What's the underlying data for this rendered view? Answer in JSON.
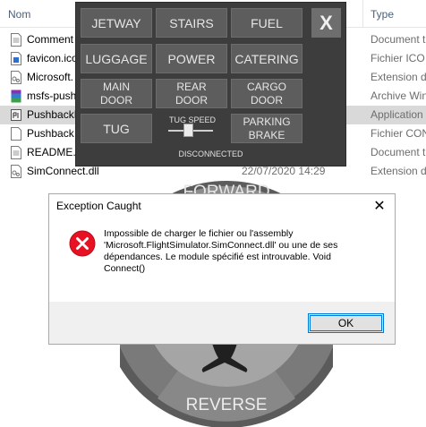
{
  "explorer": {
    "columns": {
      "name": "Nom",
      "type": "Type"
    },
    "files": [
      {
        "name": "Comment",
        "type": "Document t",
        "date": ""
      },
      {
        "name": "favicon.ico",
        "type": "Fichier ICO",
        "date": ""
      },
      {
        "name": "Microsoft.",
        "type": "Extension d",
        "date": ""
      },
      {
        "name": "msfs-push",
        "type": "Archive Win",
        "date": ""
      },
      {
        "name": "PushbackH",
        "type": "Application",
        "date": ""
      },
      {
        "name": "Pushback",
        "type": "Fichier CON",
        "date": ""
      },
      {
        "name": "README.t",
        "type": "Document t",
        "date": ""
      },
      {
        "name": "SimConnect.dll",
        "type": "Extension d",
        "date": "22/07/2020 14:29"
      }
    ]
  },
  "panel": {
    "buttons": {
      "jetway": "JETWAY",
      "stairs": "STAIRS",
      "fuel": "FUEL",
      "luggage": "LUGGAGE",
      "power": "POWER",
      "catering": "CATERING",
      "main_door_1": "MAIN",
      "main_door_2": "DOOR",
      "rear_door_1": "REAR",
      "rear_door_2": "DOOR",
      "cargo_door_1": "CARGO",
      "cargo_door_2": "DOOR",
      "tug": "TUG",
      "parking_brake_1": "PARKING",
      "parking_brake_2": "BRAKE",
      "close": "X"
    },
    "tug_speed_label": "TUG SPEED",
    "tug_speed_value": 0.45,
    "status": "DISCONNECTED"
  },
  "dial": {
    "forward": "FORWARD",
    "reverse": "REVERSE"
  },
  "dialog": {
    "title": "Exception Caught",
    "close": "✕",
    "message_lines": [
      "Impossible de charger le fichier ou l'assembly",
      "'Microsoft.FlightSimulator.SimConnect.dll' ou une de ses",
      "dépendances. Le module spécifié est introuvable. Void",
      "Connect()"
    ],
    "ok": "OK"
  },
  "colors": {
    "panel_bg": "#3d3d3d",
    "panel_button": "#5d5d5d",
    "error_red": "#e81123",
    "selected_row": "#d9d9d9",
    "focus_blue": "#0078d7"
  }
}
